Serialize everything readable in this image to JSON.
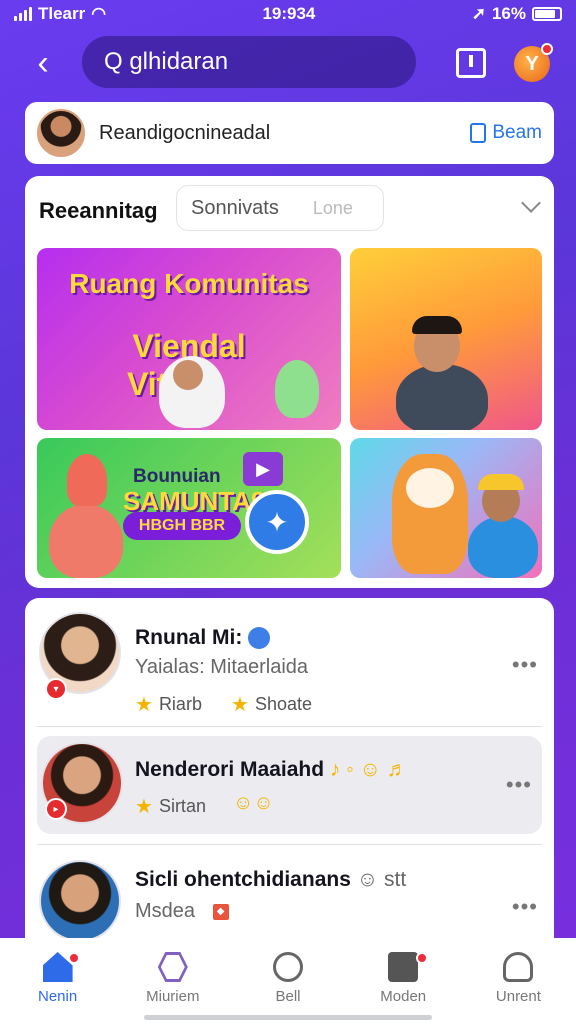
{
  "status_bar": {
    "carrier": "Tlearr",
    "time": "19:934",
    "battery": "16%"
  },
  "header": {
    "search_text": "Q glhidaran"
  },
  "profile": {
    "name": "Reandigocnineadal",
    "action_label": "Beam"
  },
  "main": {
    "title": "Reeannitag",
    "segments": [
      "Sonnivats",
      "Lone"
    ],
    "tiles": [
      {
        "line1": "Ruang Komunitas",
        "line2": "Viendal",
        "line3": "Vitaap"
      },
      {},
      {
        "line1": "Bounuian",
        "line2": "SAMUNTA9",
        "pill": "HBGH BBR"
      },
      {}
    ]
  },
  "feed": [
    {
      "name": "Rnunal Mi:",
      "subtitle": "Yaialas: Mitaerlaida",
      "tag1": "Riarb",
      "tag2": "Shoate"
    },
    {
      "name": "Nenderori Maaiahd",
      "emoji": "♪ ◦ ☺ ♬",
      "tag1": "Sirtan",
      "tag2": "☺☺"
    },
    {
      "name": "Sicli ohentchidianans",
      "emoji": "☺ stt",
      "subtitle": "Msdea"
    }
  ],
  "nav": [
    {
      "label": "Nenin",
      "icon": "home-icon"
    },
    {
      "label": "Miuriem",
      "icon": "hexagon-icon"
    },
    {
      "label": "Bell",
      "icon": "compass-icon"
    },
    {
      "label": "Moden",
      "icon": "message-icon"
    },
    {
      "label": "Unrent",
      "icon": "user-icon"
    }
  ],
  "colors": {
    "accent": "#2d6be8",
    "badge": "#e52b30",
    "background": "#6a3cf0"
  }
}
